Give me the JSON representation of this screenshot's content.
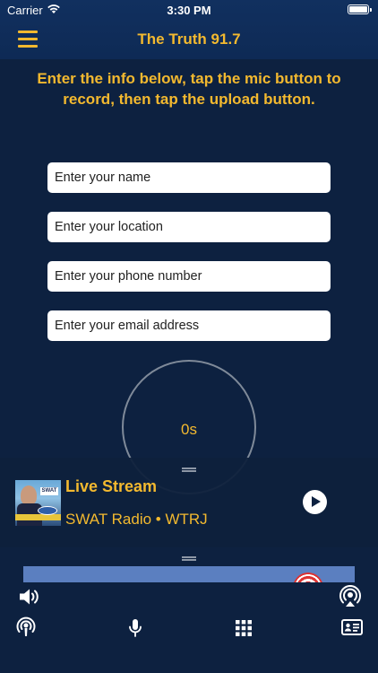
{
  "status_bar": {
    "carrier": "Carrier",
    "time": "3:30 PM"
  },
  "header": {
    "title": "The Truth 91.7"
  },
  "instructions": "Enter the info below, tap the mic button to record, then tap the upload button.",
  "form": {
    "name_placeholder": "Enter your name",
    "location_placeholder": "Enter your location",
    "phone_placeholder": "Enter your phone number",
    "email_placeholder": "Enter your email address"
  },
  "recorder": {
    "duration": "0s"
  },
  "player": {
    "title": "Live Stream",
    "subtitle": "SWAT Radio • WTRJ",
    "artwork_text": "SWAT"
  },
  "toolbar": {
    "icons": [
      "volume-icon",
      "airplay-icon",
      "podcast-icon",
      "microphone-icon",
      "grid-icon",
      "contact-card-icon"
    ]
  },
  "colors": {
    "accent": "#f3b92f",
    "background": "#0d2140",
    "header": "#11305f"
  }
}
